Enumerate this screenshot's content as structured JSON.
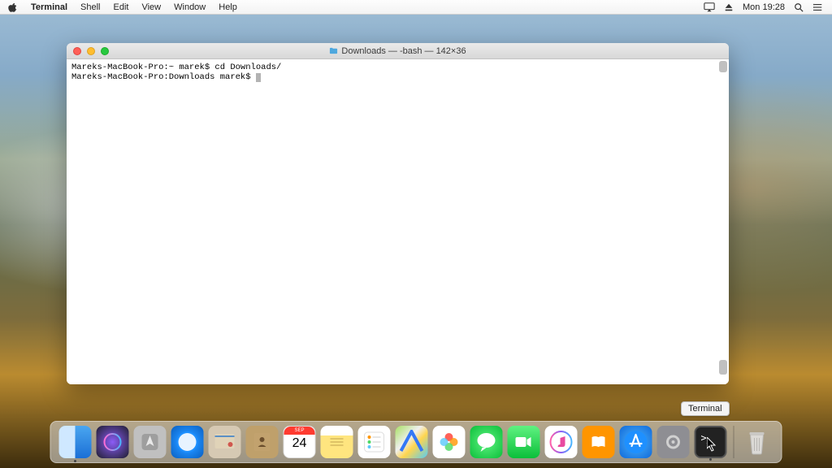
{
  "menubar": {
    "app_name": "Terminal",
    "items": [
      "Shell",
      "Edit",
      "View",
      "Window",
      "Help"
    ],
    "clock": "Mon 19:28"
  },
  "window": {
    "title_folder_icon": "home-icon",
    "title": "Downloads — -bash — 142×36"
  },
  "terminal": {
    "line1": "Mareks-MacBook-Pro:~ marek$ cd Downloads/",
    "line2_prompt": "Mareks-MacBook-Pro:Downloads marek$ "
  },
  "tooltip": {
    "label": "Terminal"
  },
  "dock": {
    "icons": [
      {
        "name": "finder",
        "running": true
      },
      {
        "name": "siri",
        "running": false
      },
      {
        "name": "launchpad",
        "running": false
      },
      {
        "name": "safari",
        "running": false
      },
      {
        "name": "mail",
        "running": false
      },
      {
        "name": "contacts",
        "running": false
      },
      {
        "name": "calendar",
        "running": false,
        "month": "SEP",
        "day": "24"
      },
      {
        "name": "notes",
        "running": false
      },
      {
        "name": "reminders",
        "running": false
      },
      {
        "name": "maps",
        "running": false
      },
      {
        "name": "photos",
        "running": false
      },
      {
        "name": "messages",
        "running": false
      },
      {
        "name": "facetime",
        "running": false
      },
      {
        "name": "itunes",
        "running": false
      },
      {
        "name": "ibooks",
        "running": false
      },
      {
        "name": "appstore",
        "running": false
      },
      {
        "name": "prefs",
        "running": false
      },
      {
        "name": "terminal",
        "running": true
      }
    ]
  }
}
